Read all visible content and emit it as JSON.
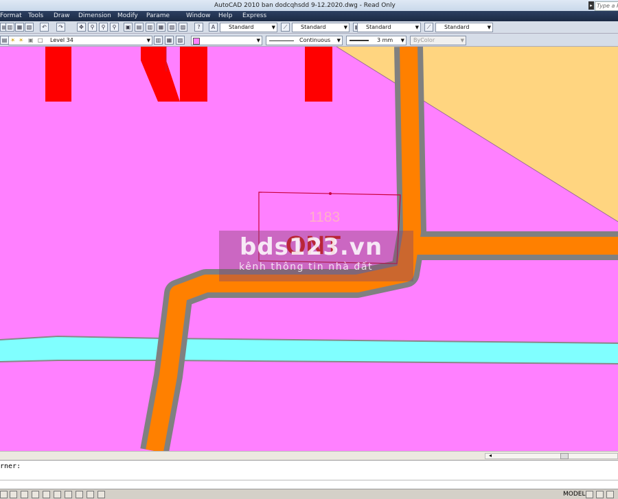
{
  "window": {
    "title": "AutoCAD 2010    ban dodcqhsdd 9-12.2020.dwg - Read Only",
    "search_placeholder": "Type a k"
  },
  "menu": [
    "Format",
    "Tools",
    "Draw",
    "Dimension",
    "Modify",
    "Parame",
    "Window",
    "Help",
    "Express"
  ],
  "styles_toolbar": {
    "text_style": "Standard",
    "dim_style": "Standard",
    "table_style": "Standard",
    "mleader_style": "Standard"
  },
  "layers_toolbar": {
    "layer": "Level 34",
    "linetype": "Continuous",
    "lineweight": "3 mm",
    "plotstyle": "ByColor"
  },
  "drawing": {
    "parcel_number": "1183",
    "land_code": "ONT",
    "colors": {
      "residential": "#ff80ff",
      "road": "#ff8000",
      "road_edge": "#808080",
      "water": "#80ffff",
      "agri": "#ffd580",
      "label_red": "#ff0000",
      "parcel_line": "#c8003a"
    }
  },
  "watermark": {
    "brand": "bds123.vn",
    "tagline": "kênh thông tin nhà đất"
  },
  "command_line": {
    "text": "rner:"
  },
  "status_bar": {
    "space": "MODEL"
  }
}
